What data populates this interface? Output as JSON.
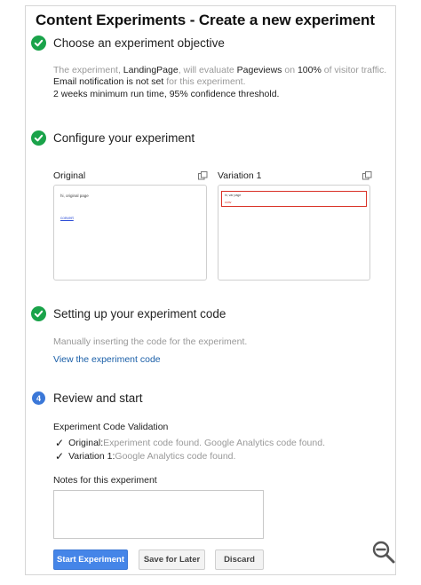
{
  "title": "Content Experiments - Create a new experiment",
  "steps": {
    "objective": {
      "label": "Choose an experiment objective"
    },
    "configure": {
      "label": "Configure your experiment"
    },
    "code": {
      "label": "Setting up your experiment code"
    },
    "review": {
      "label": "Review and start",
      "number": "4"
    }
  },
  "summary": {
    "p1": "The experiment, ",
    "page": "LandingPage",
    "p2": ", will evaluate ",
    "metric": "Pageviews",
    "p3": " on ",
    "percent": "100%",
    "p4": " of visitor traffic.",
    "email_a": "Email notification is not set",
    "email_b": " for this experiment.",
    "line3": "2 weeks minimum run time, 95% confidence threshold."
  },
  "variants": {
    "original": {
      "label": "Original",
      "thumb_text": "hi, original page",
      "thumb_link": "convert"
    },
    "variation1": {
      "label": "Variation 1",
      "thumb_text": "hi, var page",
      "thumb_link": "conv"
    }
  },
  "code_section": {
    "description": "Manually inserting the code for the experiment.",
    "link": "View the experiment code"
  },
  "validation": {
    "heading": "Experiment Code Validation",
    "rows": [
      {
        "label": "Original:",
        "status": " Experiment code found. Google Analytics code found."
      },
      {
        "label": "Variation 1:",
        "status": " Google Analytics code found."
      }
    ]
  },
  "notes": {
    "label": "Notes for this experiment",
    "value": ""
  },
  "buttons": {
    "start": "Start Experiment",
    "save": "Save for Later",
    "discard": "Discard"
  },
  "icons": {
    "step_done": "check-circle-icon",
    "copy": "copy-icon",
    "zoom": "zoom-out-icon"
  },
  "colors": {
    "success": "#1aa34a",
    "primary": "#4585e8",
    "link": "#1a5fa8",
    "step_active": "#3b78d8",
    "highlight": "#d93025"
  }
}
